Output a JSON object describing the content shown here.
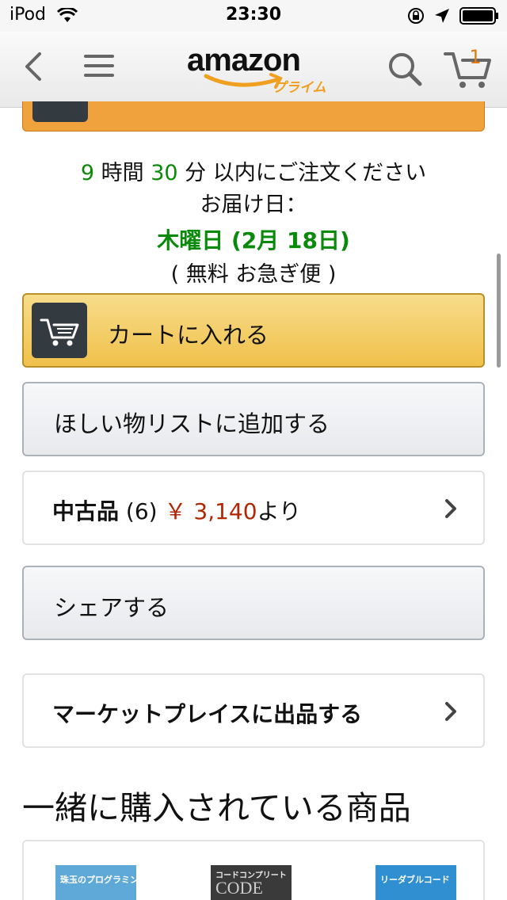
{
  "status_bar": {
    "device": "iPod",
    "time": "23:30"
  },
  "header": {
    "logo_text": "amazon",
    "logo_sub": "プライム",
    "cart_count": "1"
  },
  "delivery": {
    "hours": "9",
    "hours_unit": " 時間 ",
    "minutes": "30",
    "minutes_unit": " 分 以内にご注文ください",
    "date_label": "お届け日：",
    "date": "木曜日 (2月 18日)",
    "shipping": "( 無料 お急ぎ便 )"
  },
  "buttons": {
    "add_to_cart": "カートに入れる",
    "wishlist": "ほしい物リストに追加する",
    "share": "シェアする"
  },
  "used": {
    "label": "中古品",
    "count": "(6)",
    "price": "￥ 3,140",
    "suffix": "より"
  },
  "marketplace": {
    "label": "マーケットプレイスに出品する"
  },
  "section": {
    "title": "一緒に購入されている商品"
  },
  "products": [
    {
      "cover_text": "珠玉のプログラミング"
    },
    {
      "cover_text": "コードコンプリート",
      "cover_main": "CODE"
    },
    {
      "cover_text": "リーダブルコード"
    }
  ],
  "colors": {
    "accent_green": "#0a8a0a",
    "price_red": "#b12704",
    "cart_button": "#f0c14b",
    "amazon_orange": "#f0a020"
  }
}
